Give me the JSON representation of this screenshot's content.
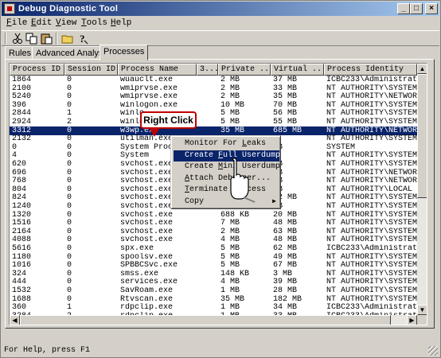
{
  "window": {
    "title": "Debug Diagnostic Tool",
    "controls": {
      "minimize": "_",
      "maximize": "□",
      "close": "×"
    }
  },
  "menubar": {
    "items": [
      {
        "label": "File",
        "accel": "F",
        "rest": "ile"
      },
      {
        "label": "Edit",
        "accel": "E",
        "rest": "dit"
      },
      {
        "label": "View",
        "accel": "V",
        "rest": "iew"
      },
      {
        "label": "Tools",
        "accel": "T",
        "rest": "ools"
      },
      {
        "label": "Help",
        "accel": "H",
        "rest": "elp"
      }
    ]
  },
  "toolbar": {
    "icons": [
      "cut-icon",
      "copy-icon",
      "paste-icon",
      "open-folder-icon",
      "help-icon"
    ]
  },
  "tabs": [
    {
      "label": "Rules",
      "active": false
    },
    {
      "label": "Advanced Analysis",
      "active": false
    },
    {
      "label": "Processes",
      "active": true
    }
  ],
  "columns": [
    "Process ID",
    "Session ID",
    "Process Name",
    "3...",
    "Private ...",
    "Virtual ...",
    "Process Identity"
  ],
  "rows": [
    [
      "1864",
      "0",
      "wuauclt.exe",
      "",
      "2 MB",
      "37 MB",
      "ICBC233\\Administrator"
    ],
    [
      "2100",
      "0",
      "wmiprvse.exe",
      "",
      "2 MB",
      "33 MB",
      "NT AUTHORITY\\SYSTEM"
    ],
    [
      "5240",
      "0",
      "wmiprvse.exe",
      "",
      "2 MB",
      "35 MB",
      "NT AUTHORITY\\NETWORK..."
    ],
    [
      "396",
      "0",
      "winlogon.exe",
      "",
      "10 MB",
      "70 MB",
      "NT AUTHORITY\\SYSTEM"
    ],
    [
      "2844",
      "1",
      "winlo",
      "",
      "5 MB",
      "56 MB",
      "NT AUTHORITY\\SYSTEM"
    ],
    [
      "2924",
      "2",
      "winlo",
      "",
      "5 MB",
      "55 MB",
      "NT AUTHORITY\\SYSTEM"
    ],
    [
      "3312",
      "0",
      "w3wp.exe",
      "",
      "35 MB",
      "685 MB",
      "NT AUTHORITY\\NETWORK..."
    ],
    [
      "2132",
      "0",
      "utilman.exe",
      "",
      "",
      "",
      "NT AUTHORITY\\SYSTEM"
    ],
    [
      "0",
      "0",
      "System Proce",
      "",
      "",
      "KB",
      "SYSTEM"
    ],
    [
      "4",
      "0",
      "System",
      "",
      "",
      "B",
      "NT AUTHORITY\\SYSTEM"
    ],
    [
      "620",
      "0",
      "svchost.exe",
      "",
      "",
      "MB",
      "NT AUTHORITY\\SYSTEM"
    ],
    [
      "696",
      "0",
      "svchost.exe",
      "",
      "",
      "MB",
      "NT AUTHORITY\\NETWORK..."
    ],
    [
      "768",
      "0",
      "svchost.exe",
      "",
      "",
      "MB",
      "NT AUTHORITY\\NETWORK..."
    ],
    [
      "804",
      "0",
      "svchost.exe",
      "",
      "",
      "MB",
      "NT AUTHORITY\\LOCAL S..."
    ],
    [
      "824",
      "0",
      "svchost.exe",
      "",
      "",
      "42 MB",
      "NT AUTHORITY\\SYSTEM"
    ],
    [
      "1240",
      "0",
      "svchost.exe",
      "",
      "",
      "MB",
      "NT AUTHORITY\\SYSTEM"
    ],
    [
      "1320",
      "0",
      "svchost.exe",
      "",
      "688 KB",
      "20 MB",
      "NT AUTHORITY\\SYSTEM"
    ],
    [
      "1516",
      "0",
      "svchost.exe",
      "",
      "7 MB",
      "48 MB",
      "NT AUTHORITY\\SYSTEM"
    ],
    [
      "2164",
      "0",
      "svchost.exe",
      "",
      "2 MB",
      "63 MB",
      "NT AUTHORITY\\SYSTEM"
    ],
    [
      "4088",
      "0",
      "svchost.exe",
      "",
      "4 MB",
      "48 MB",
      "NT AUTHORITY\\SYSTEM"
    ],
    [
      "5616",
      "0",
      "spx.exe",
      "",
      "5 MB",
      "62 MB",
      "ICBC233\\Administrator"
    ],
    [
      "1180",
      "0",
      "spoolsv.exe",
      "",
      "5 MB",
      "49 MB",
      "NT AUTHORITY\\SYSTEM"
    ],
    [
      "1016",
      "0",
      "SPBBCSvc.exe",
      "",
      "5 MB",
      "67 MB",
      "NT AUTHORITY\\SYSTEM"
    ],
    [
      "324",
      "0",
      "smss.exe",
      "",
      "148 KB",
      "3 MB",
      "NT AUTHORITY\\SYSTEM"
    ],
    [
      "444",
      "0",
      "services.exe",
      "",
      "4 MB",
      "39 MB",
      "NT AUTHORITY\\SYSTEM"
    ],
    [
      "1532",
      "0",
      "SavRoam.exe",
      "",
      "1 MB",
      "28 MB",
      "NT AUTHORITY\\SYSTEM"
    ],
    [
      "1688",
      "0",
      "Rtvscan.exe",
      "",
      "35 MB",
      "182 MB",
      "NT AUTHORITY\\SYSTEM"
    ],
    [
      "360",
      "1",
      "rdpclip.exe",
      "",
      "1 MB",
      "34 MB",
      "ICBC233\\Administrator"
    ],
    [
      "3284",
      "2",
      "rdpclip.exe",
      "",
      "1 MB",
      "33 MB",
      "ICBC233\\Administrator"
    ]
  ],
  "selected_row_index": 6,
  "context_menu": {
    "items": [
      {
        "label": "Monitor For Leaks",
        "pre": "Monitor For ",
        "accel": "L",
        "post": "eaks",
        "hover": false,
        "submenu": false
      },
      {
        "label": "Create Full Userdump",
        "pre": "Create ",
        "accel": "F",
        "post": "ull Userdump",
        "hover": true,
        "submenu": false
      },
      {
        "label": "Create Mini Userdump",
        "pre": "Create ",
        "accel": "M",
        "post": "ini Userdump",
        "hover": false,
        "submenu": false
      },
      {
        "label": "Attach Debugger...",
        "pre": "",
        "accel": "A",
        "post": "ttach Debugger...",
        "hover": false,
        "submenu": false
      },
      {
        "label": "Terminate Process",
        "pre": "",
        "accel": "T",
        "post": "erminate Process",
        "hover": false,
        "submenu": false
      },
      {
        "label": "Copy",
        "pre": "",
        "accel": "",
        "post": "Copy",
        "hover": false,
        "submenu": true
      }
    ]
  },
  "callout": {
    "text": "Right Click"
  },
  "statusbar": {
    "text": "For Help, press F1"
  },
  "colors": {
    "selection": "#0a246a",
    "callout_border": "#c00000",
    "face": "#d4d0c8"
  }
}
